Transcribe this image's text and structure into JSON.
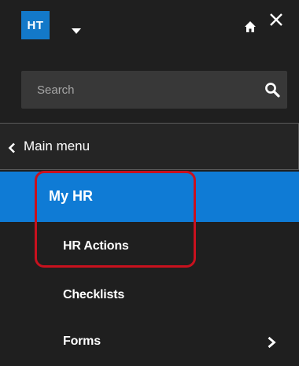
{
  "header": {
    "org_badge": "HT",
    "home_icon": "home-icon",
    "close_label": "X"
  },
  "search": {
    "placeholder": "Search",
    "value": ""
  },
  "nav": {
    "back_label": "Main menu",
    "active_section": "My HR",
    "items": [
      {
        "label": "HR Actions"
      },
      {
        "label": "Checklists"
      },
      {
        "label": "Forms",
        "has_submenu": true
      }
    ]
  },
  "colors": {
    "background": "#1f1f1f",
    "accent": "#0f7bd5",
    "badge": "#1379c9",
    "highlight_outline": "#c8111e"
  }
}
